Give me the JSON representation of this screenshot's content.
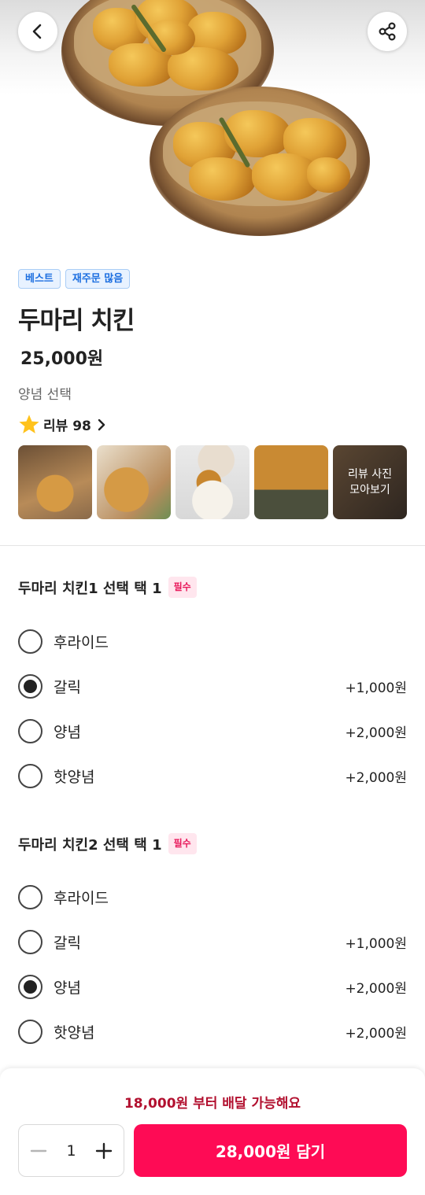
{
  "header": {
    "back_icon": "chevron-left-icon",
    "share_icon": "share-icon"
  },
  "product": {
    "badges": [
      "베스트",
      "재주문 많음"
    ],
    "name": "두마리 치킨",
    "price": "25,000원",
    "description": "양념 선택",
    "review_label": "리뷰 98",
    "more_photos": "리뷰 사진\n모아보기"
  },
  "option_groups": [
    {
      "title": "두마리 치킨1 선택 택 1",
      "required_badge": "필수",
      "options": [
        {
          "name": "후라이드",
          "price": "",
          "selected": false
        },
        {
          "name": "갈릭",
          "price": "+1,000원",
          "selected": true
        },
        {
          "name": "양념",
          "price": "+2,000원",
          "selected": false
        },
        {
          "name": "핫양념",
          "price": "+2,000원",
          "selected": false
        }
      ]
    },
    {
      "title": "두마리 치킨2 선택 택 1",
      "required_badge": "필수",
      "options": [
        {
          "name": "후라이드",
          "price": "",
          "selected": false
        },
        {
          "name": "갈릭",
          "price": "+1,000원",
          "selected": false
        },
        {
          "name": "양념",
          "price": "+2,000원",
          "selected": true
        },
        {
          "name": "핫양념",
          "price": "+2,000원",
          "selected": false
        }
      ]
    }
  ],
  "bottom_bar": {
    "min_order_text": "18,000원 부터 배달 가능해요",
    "quantity": "1",
    "add_button_label": "28,000원 담기"
  },
  "colors": {
    "accent": "#fe0b55",
    "min_order_text": "#b2102f",
    "badge_blue": "#1d6fe0",
    "required_pink": "#e8195b"
  }
}
